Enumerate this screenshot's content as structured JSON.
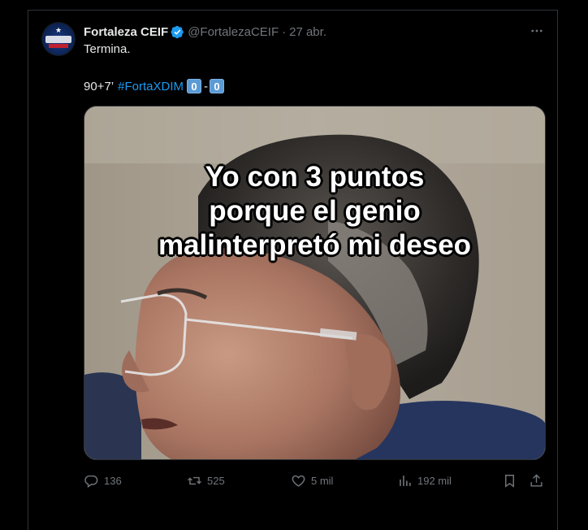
{
  "tweet": {
    "display_name": "Fortaleza CEIF",
    "handle": "@FortalezaCEIF",
    "separator": "·",
    "date": "27 abr.",
    "text_line1": "Termina.",
    "text_line2_prefix": "90+7’",
    "hashtag": "#FortaXDIM",
    "score_home": "0",
    "score_dash": "-",
    "score_away": "0",
    "verified_badge": "verified-icon",
    "more_icon": "more-horizontal-icon"
  },
  "media": {
    "caption_lines": [
      "Yo con 3 puntos",
      "porque el genio",
      "malinterpretó mi deseo"
    ]
  },
  "actions": {
    "reply_count": "136",
    "retweet_count": "525",
    "like_count": "5 mil",
    "views_count": "192 mil"
  },
  "colors": {
    "background": "#000000",
    "text_primary": "#e7e9ea",
    "text_secondary": "#71767b",
    "accent": "#1d9bf0",
    "border": "#2f3336"
  }
}
